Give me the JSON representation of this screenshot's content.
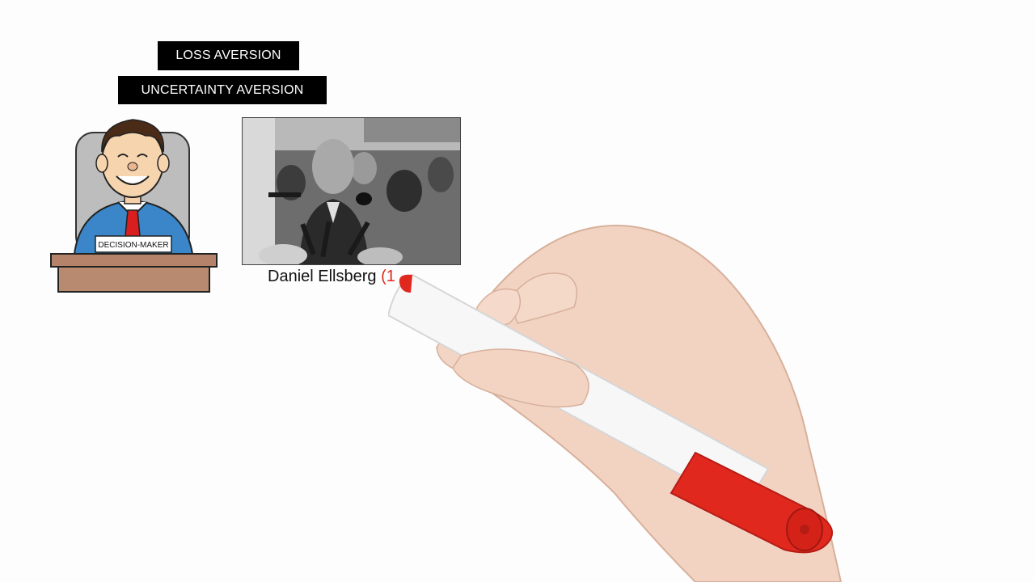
{
  "labels": {
    "loss_aversion": "LOSS AVERSION",
    "uncertainty_aversion": "UNCERTAINTY AVERSION"
  },
  "cartoon": {
    "desk_sign": "DECISION-MAKER"
  },
  "caption": {
    "name": "Daniel Ellsberg",
    "partial": "(1"
  },
  "colors": {
    "label_background": "#000000",
    "label_text": "#ffffff",
    "marker_red": "#e0281e",
    "shirt_blue": "#3a86c8",
    "tie_red": "#d81e1e",
    "desk_brown": "#b5836a"
  },
  "icons": {
    "cartoon": "decision-maker-illustration",
    "photo": "press-crowd-photo",
    "hand": "hand-with-marker"
  }
}
